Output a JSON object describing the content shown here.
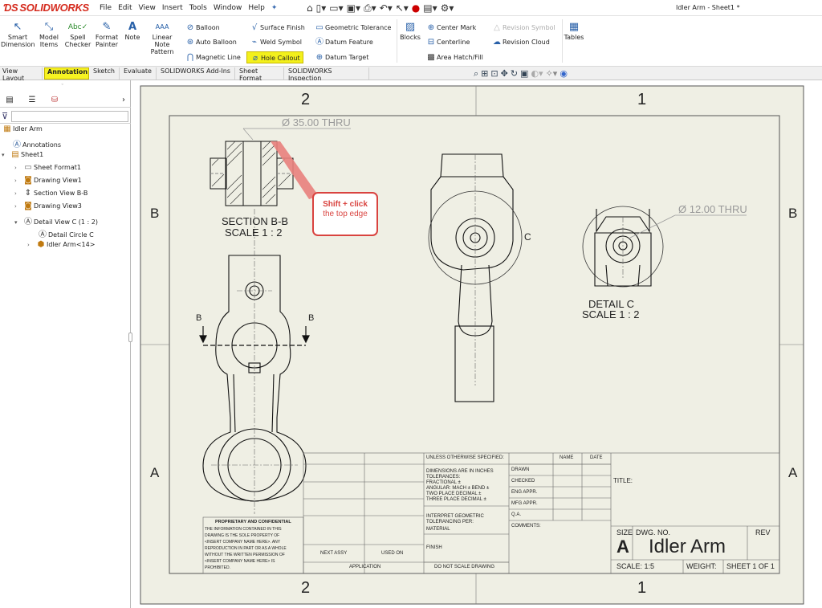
{
  "app": {
    "logo": "SOLIDWORKS",
    "doc_title": "Idler Arm - Sheet1 *"
  },
  "menu": [
    "File",
    "Edit",
    "View",
    "Insert",
    "Tools",
    "Window",
    "Help"
  ],
  "ribbon": {
    "smart_dimension": "Smart Dimension",
    "model_items": "Model Items",
    "spell_checker": "Spell Checker",
    "format_painter": "Format Painter",
    "note": "Note",
    "linear_note_pattern": "Linear Note Pattern",
    "balloon": "Balloon",
    "auto_balloon": "Auto Balloon",
    "magnetic_line": "Magnetic Line",
    "surface_finish": "Surface Finish",
    "weld_symbol": "Weld Symbol",
    "hole_callout": "Hole Callout",
    "geometric_tolerance": "Geometric Tolerance",
    "datum_feature": "Datum Feature",
    "datum_target": "Datum Target",
    "blocks": "Blocks",
    "center_mark": "Center Mark",
    "centerline": "Centerline",
    "area_hatch": "Area Hatch/Fill",
    "revision_symbol": "Revision Symbol",
    "revision_cloud": "Revision Cloud",
    "tables": "Tables"
  },
  "tabs": [
    "View Layout",
    "Annotation",
    "Sketch",
    "Evaluate",
    "SOLIDWORKS Add-Ins",
    "Sheet Format",
    "SOLIDWORKS Inspection"
  ],
  "tree": {
    "root": "Idler Arm",
    "annotations": "Annotations",
    "sheet": "Sheet1",
    "sheet_format": "Sheet Format1",
    "view1": "Drawing View1",
    "section": "Section View B-B",
    "view3": "Drawing View3",
    "detail": "Detail View C (1 : 2)",
    "detail_circle": "Detail Circle C",
    "part": "Idler Arm<14>"
  },
  "drawing": {
    "zone_top_left": "2",
    "zone_top_right": "1",
    "zone_bottom_left": "2",
    "zone_bottom_right": "1",
    "zone_b": "B",
    "zone_a": "A",
    "hole_callout_1": "Ø 35.00 THRU",
    "hole_callout_2": "Ø 12.00 THRU",
    "section_title": "SECTION B-B",
    "section_scale": "SCALE 1 : 2",
    "detail_title": "DETAIL C",
    "detail_scale": "SCALE 1 : 2",
    "detail_label": "C",
    "section_label": "B"
  },
  "callout": {
    "title": "Shift + click",
    "sub": "the top edge"
  },
  "title_block": {
    "unless": "UNLESS OTHERWISE SPECIFIED:",
    "name": "NAME",
    "date": "DATE",
    "dims": "DIMENSIONS ARE IN INCHES",
    "tolerances": "TOLERANCES:",
    "fractional": "FRACTIONAL ±",
    "angular": "ANGULAR: MACH ±   BEND ±",
    "two_place": "TWO PLACE DECIMAL   ±",
    "three_place": "THREE PLACE DECIMAL  ±",
    "interpret": "INTERPRET GEOMETRIC",
    "toleranced": "TOLERANCING PER:",
    "material": "MATERIAL",
    "finish": "FINISH",
    "drawn": "DRAWN",
    "checked": "CHECKED",
    "eng": "ENG APPR.",
    "mfg": "MFG APPR.",
    "qa": "Q.A.",
    "comments": "COMMENTS:",
    "title": "TITLE:",
    "size": "SIZE",
    "size_val": "A",
    "dwg_no": "DWG. NO.",
    "dwg_val": "Idler Arm",
    "rev": "REV",
    "scale": "SCALE: 1:5",
    "weight": "WEIGHT:",
    "sheet": "SHEET 1 OF 1",
    "next_assy": "NEXT ASSY",
    "used_on": "USED ON",
    "application": "APPLICATION",
    "no_scale": "DO NOT SCALE DRAWING",
    "proprietary": "PROPRIETARY AND CONFIDENTIAL",
    "prop_l1": "THE INFORMATION CONTAINED IN THIS",
    "prop_l2": "DRAWING IS THE SOLE PROPERTY OF",
    "prop_l3": "<INSERT COMPANY NAME HERE>.  ANY",
    "prop_l4": "REPRODUCTION IN PART OR AS A WHOLE",
    "prop_l5": "WITHOUT THE WRITTEN PERMISSION OF",
    "prop_l6": "<INSERT COMPANY NAME HERE> IS",
    "prop_l7": "PROHIBITED."
  },
  "colors": {
    "accent": "#d52b1e",
    "highlight": "#f3f01c",
    "sheet": "#efefe4",
    "callout": "#d9433f"
  }
}
